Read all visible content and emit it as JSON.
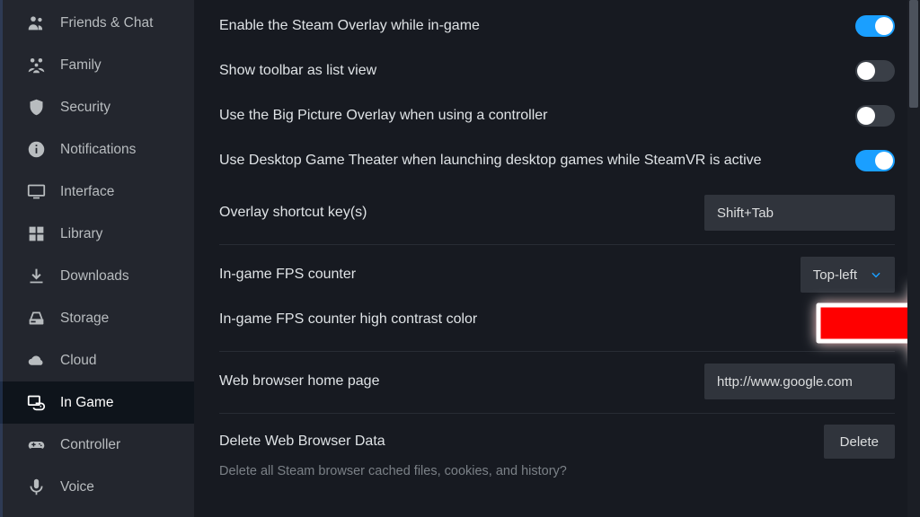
{
  "sidebar": {
    "items": [
      {
        "id": "friends-chat",
        "label": "Friends & Chat",
        "icon": "friends"
      },
      {
        "id": "family",
        "label": "Family",
        "icon": "family"
      },
      {
        "id": "security",
        "label": "Security",
        "icon": "shield"
      },
      {
        "id": "notifications",
        "label": "Notifications",
        "icon": "info"
      },
      {
        "id": "interface",
        "label": "Interface",
        "icon": "monitor"
      },
      {
        "id": "library",
        "label": "Library",
        "icon": "grid"
      },
      {
        "id": "downloads",
        "label": "Downloads",
        "icon": "download"
      },
      {
        "id": "storage",
        "label": "Storage",
        "icon": "drive"
      },
      {
        "id": "cloud",
        "label": "Cloud",
        "icon": "cloud"
      },
      {
        "id": "in-game",
        "label": "In Game",
        "icon": "ingame",
        "active": true
      },
      {
        "id": "controller",
        "label": "Controller",
        "icon": "controller"
      },
      {
        "id": "voice",
        "label": "Voice",
        "icon": "mic"
      }
    ]
  },
  "settings": {
    "enable_overlay": {
      "label": "Enable the Steam Overlay while in-game",
      "value": true
    },
    "toolbar_list": {
      "label": "Show toolbar as list view",
      "value": false
    },
    "big_picture_overlay": {
      "label": "Use the Big Picture Overlay when using a controller",
      "value": false
    },
    "desktop_theater": {
      "label": "Use Desktop Game Theater when launching desktop games while SteamVR is active",
      "value": true
    },
    "overlay_shortcut": {
      "label": "Overlay shortcut key(s)",
      "value": "Shift+Tab"
    },
    "fps_counter": {
      "label": "In-game FPS counter",
      "value": "Top-left"
    },
    "fps_high_contrast": {
      "label": "In-game FPS counter high contrast color",
      "value": false
    },
    "browser_home": {
      "label": "Web browser home page",
      "value": "http://www.google.com"
    },
    "delete_browser": {
      "label": "Delete Web Browser Data",
      "button": "Delete",
      "subtext": "Delete all Steam browser cached files, cookies, and history?"
    }
  }
}
